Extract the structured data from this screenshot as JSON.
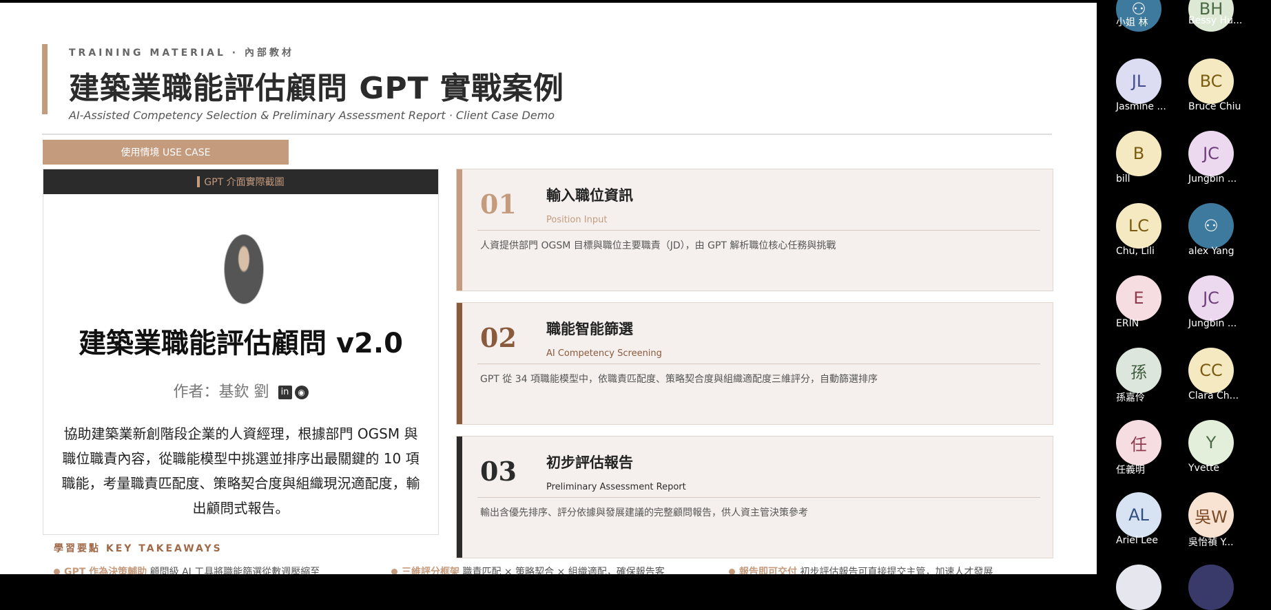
{
  "slide": {
    "eyebrow": "TRAINING MATERIAL  ·  內部教材",
    "title": "建築業職能評估顧問 GPT 實戰案例",
    "subtitle": "AI-Assisted Competency Selection & Preliminary Assessment Report · Client Case Demo",
    "usecase_label": "使用情境  USE CASE",
    "left_card": {
      "header": "GPT 介面實際截圖",
      "gpt_name": "建築業職能評估顧問 v2.0",
      "author": "作者：基欽 劉",
      "description": "協助建築業新創階段企業的人資經理，根據部門 OGSM 與職位職責內容，從職能模型中挑選並排序出最關鍵的 10 項職能，考量職責匹配度、策略契合度與組織現況適配度，輸出顧問式報告。"
    },
    "steps": [
      {
        "num": "01",
        "title": "輸入職位資訊",
        "en": "Position Input",
        "desc": "人資提供部門 OGSM 目標與職位主要職責（JD），由 GPT 解析職位核心任務與挑戰",
        "color": "#c59b7e",
        "en_color": "#c59b7e"
      },
      {
        "num": "02",
        "title": "職能智能篩選",
        "en": "AI Competency Screening",
        "desc": "GPT 從 34 項職能模型中，依職責匹配度、策略契合度與組織適配度三維評分，自動篩選排序",
        "color": "#8a5a3c",
        "en_color": "#8a5a3c"
      },
      {
        "num": "03",
        "title": "初步評估報告",
        "en": "Preliminary Assessment Report",
        "desc": "輸出含優先排序、評分依據與發展建議的完整顧問報告，供人資主管決策參考",
        "color": "#2b2b2b",
        "en_color": "#2b2b2b"
      }
    ],
    "takeaways_label": "學習要點    KEY TAKEAWAYS",
    "takeaways": [
      {
        "bold": "GPT 作為決策輔助",
        "text": "顧問級 AI 工具將職能篩選從數週壓縮至"
      },
      {
        "bold": "三維評分框架",
        "text": "職責匹配 × 策略契合 × 組織適配，確保報告客"
      },
      {
        "bold": "報告即可交付",
        "text": "初步評估報告可直接提交主管，加速人才發展"
      }
    ]
  },
  "participants": [
    {
      "initials": "",
      "name": "小姐 林",
      "bg": "#3e7a9e",
      "fg": "#fff",
      "icon": "user-icon"
    },
    {
      "initials": "BH",
      "name": "Bessy Hu...",
      "bg": "#dde8d5",
      "fg": "#4a6b45"
    },
    {
      "initials": "JL",
      "name": "Jasmine ...",
      "bg": "#dcdcf2",
      "fg": "#444c8c"
    },
    {
      "initials": "BC",
      "name": "Bruce Chiu",
      "bg": "#f5e9c2",
      "fg": "#7a5c10"
    },
    {
      "initials": "B",
      "name": "bill",
      "bg": "#f5e9c2",
      "fg": "#7a5c10"
    },
    {
      "initials": "JC",
      "name": "Jungbin ...",
      "bg": "#ecd9ef",
      "fg": "#6f3f79"
    },
    {
      "initials": "LC",
      "name": "Chu, Lili",
      "bg": "#f5e9c2",
      "fg": "#7a5c10"
    },
    {
      "initials": "",
      "name": "alex Yang",
      "bg": "#3e7a9e",
      "fg": "#fff",
      "icon": "user-icon"
    },
    {
      "initials": "E",
      "name": "ERIN",
      "bg": "#f6dde2",
      "fg": "#8c3a4c"
    },
    {
      "initials": "JC",
      "name": "Jungbin ...",
      "bg": "#ecd9ef",
      "fg": "#6f3f79"
    },
    {
      "initials": "孫",
      "name": "孫嘉伶",
      "bg": "#dce6dc",
      "fg": "#3f5a3f"
    },
    {
      "initials": "CC",
      "name": "Clara Ch...",
      "bg": "#f5e9c2",
      "fg": "#7a5c10"
    },
    {
      "initials": "任",
      "name": "任義明",
      "bg": "#f6dde2",
      "fg": "#8c3a4c"
    },
    {
      "initials": "Y",
      "name": "Yvette",
      "bg": "#e4efdb",
      "fg": "#4a6b45"
    },
    {
      "initials": "AL",
      "name": "Ariel Lee",
      "bg": "#d7e3f3",
      "fg": "#2f4f7f"
    },
    {
      "initials": "吳W",
      "name": "吳怡禎 Y...",
      "bg": "#f8e3d3",
      "fg": "#7a4a24"
    }
  ]
}
